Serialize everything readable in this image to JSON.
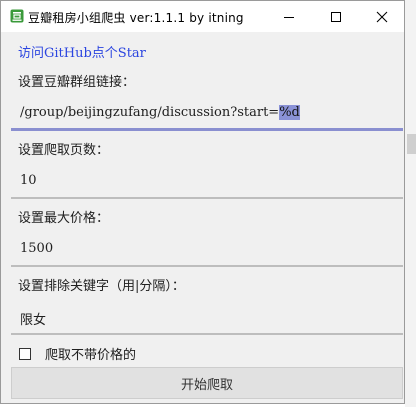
{
  "window": {
    "title": "豆瓣租房小组爬虫 ver:1.1.1 by itning",
    "icon": "douban-app-icon"
  },
  "link": {
    "text": "访问GitHub点个Star"
  },
  "group_link": {
    "label": "设置豆瓣群组链接：",
    "value_prefix": "/group/beijingzufang/discussion?start=",
    "value_selected": "%d"
  },
  "pages": {
    "label": "设置爬取页数：",
    "value": "10"
  },
  "max_price": {
    "label": "设置最大价格：",
    "value": "1500"
  },
  "exclude_keywords": {
    "label": "设置排除关键字（用|分隔）：",
    "value": "限女"
  },
  "no_price_checkbox": {
    "label": "爬取不带价格的",
    "checked": false
  },
  "start_button": {
    "label": "开始爬取"
  },
  "colors": {
    "link": "#2b45e0",
    "selection": "#8a92d6",
    "active_underline": "#8a8fd0"
  }
}
